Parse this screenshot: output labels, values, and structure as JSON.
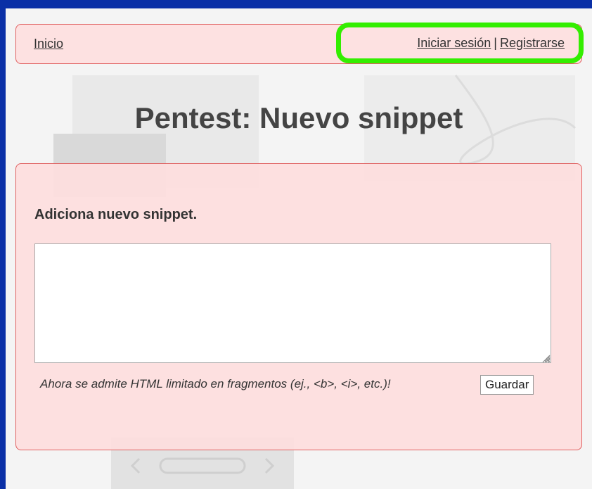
{
  "nav": {
    "home_label": "Inicio",
    "login_label": "Iniciar sesión",
    "separator": "|",
    "register_label": "Registrarse",
    "highlight_color": "#33ee00"
  },
  "page": {
    "title": "Pentest: Nuevo snippet"
  },
  "form": {
    "heading": "Adiciona nuevo snippet.",
    "snippet_value": "",
    "hint": "Ahora se admite HTML limitado en fragmentos (ej., <b>, <i>, etc.)!",
    "save_label": "Guardar"
  },
  "colors": {
    "frame": "#0a2fa6",
    "panel_bg": "#fde1e1",
    "panel_border": "#e06060",
    "title_text": "#444444"
  }
}
